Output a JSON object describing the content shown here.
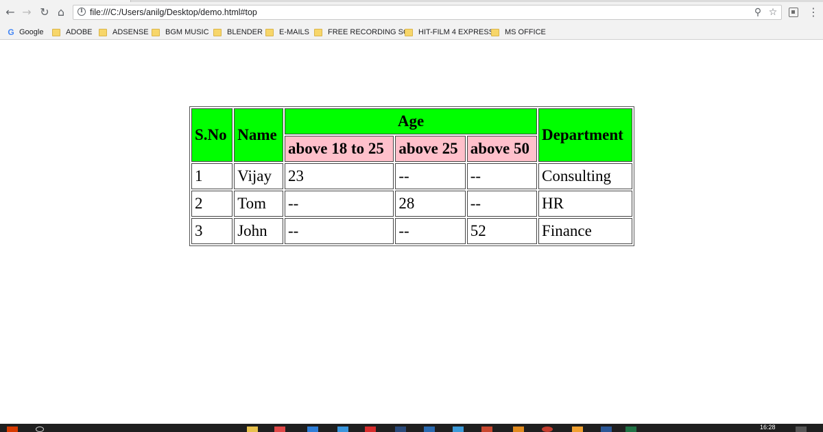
{
  "browser": {
    "url": "file:///C:/Users/anilg/Desktop/demo.html#top",
    "bookmarks": [
      {
        "label": "Google",
        "icon": "google-icon"
      },
      {
        "label": "ADOBE",
        "icon": "folder-icon"
      },
      {
        "label": "ADSENSE",
        "icon": "folder-icon"
      },
      {
        "label": "BGM MUSIC",
        "icon": "folder-icon"
      },
      {
        "label": "BLENDER",
        "icon": "folder-icon"
      },
      {
        "label": "E-MAILS",
        "icon": "folder-icon"
      },
      {
        "label": "FREE RECORDING SO",
        "icon": "folder-icon"
      },
      {
        "label": "HIT-FILM 4 EXPRESS",
        "icon": "folder-icon"
      },
      {
        "label": "MS OFFICE",
        "icon": "folder-icon"
      }
    ]
  },
  "table": {
    "headers": {
      "sno": "S.No",
      "name": "Name",
      "age": "Age",
      "age_18_25": "above 18 to 25",
      "age_25": "above 25",
      "age_50": "above 50",
      "department": "Department"
    },
    "rows": [
      {
        "sno": "1",
        "name": "Vijay",
        "a1": "23",
        "a2": "--",
        "a3": "--",
        "dept": "Consulting"
      },
      {
        "sno": "2",
        "name": "Tom",
        "a1": "--",
        "a2": "28",
        "a3": "--",
        "dept": "HR"
      },
      {
        "sno": "3",
        "name": "John",
        "a1": "--",
        "a2": "--",
        "a3": "52",
        "dept": "Finance"
      }
    ],
    "colors": {
      "header": "#00ff00",
      "subheader": "#ffc0cb"
    }
  },
  "taskbar": {
    "clock": "16:28"
  }
}
